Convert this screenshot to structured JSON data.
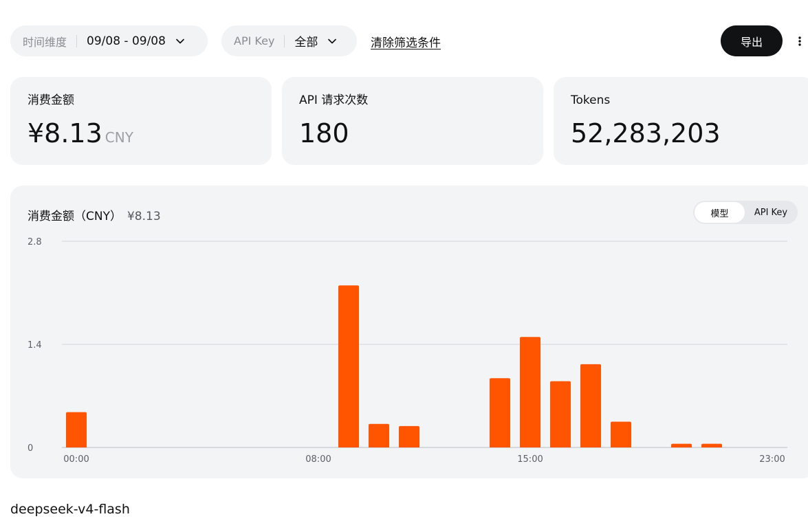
{
  "filters": {
    "time": {
      "label": "时间维度",
      "value": "09/08 - 09/08"
    },
    "api_key": {
      "label": "API Key",
      "value": "全部"
    },
    "clear_label": "清除筛选条件"
  },
  "toolbar": {
    "export_label": "导出"
  },
  "stats": {
    "spend": {
      "label": "消费金额",
      "value": "¥8.13",
      "unit": "CNY"
    },
    "requests": {
      "label": "API 请求次数",
      "value": "180"
    },
    "tokens": {
      "label": "Tokens",
      "value": "52,283,203"
    }
  },
  "chart": {
    "title": "消费金额（CNY）",
    "total": "¥8.13",
    "toggle": {
      "model_label": "模型",
      "key_label": "API Key",
      "active": "model"
    }
  },
  "chart_data": {
    "type": "bar",
    "categories": [
      "00:00",
      "01:00",
      "02:00",
      "03:00",
      "04:00",
      "05:00",
      "06:00",
      "07:00",
      "08:00",
      "09:00",
      "10:00",
      "11:00",
      "12:00",
      "13:00",
      "14:00",
      "15:00",
      "16:00",
      "17:00",
      "18:00",
      "19:00",
      "20:00",
      "21:00",
      "22:00",
      "23:00"
    ],
    "series": [
      {
        "values": [
          0.48,
          0,
          0,
          0,
          0,
          0,
          0,
          0,
          0,
          2.2,
          0.32,
          0.29,
          0,
          0,
          0.94,
          1.5,
          0.9,
          1.13,
          0.35,
          0,
          0.05,
          0.05,
          0,
          0
        ]
      }
    ],
    "ylim": [
      0,
      2.8
    ],
    "yticks": [
      "2.8",
      "1.4",
      "0"
    ],
    "xticks": [
      "00:00",
      "08:00",
      "15:00",
      "23:00"
    ],
    "bar_color": "#ff5500",
    "grid": true
  },
  "model_section": {
    "name": "deepseek-v4-flash"
  },
  "colors": {
    "accent": "#ff5500",
    "card_bg": "#f3f4f6",
    "button_dark": "#111214"
  }
}
